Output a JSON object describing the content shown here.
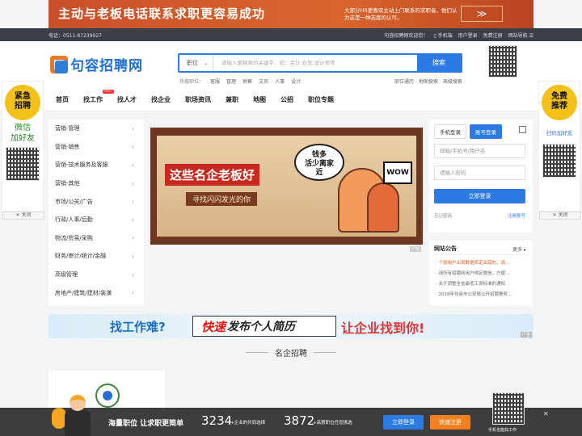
{
  "top_banner": {
    "headline": "主动与老板电话联系求职更容易成功",
    "subtext": "大部分HR更喜欢主动上门联系的求职者，他们认为这是一种态度的认可。",
    "arrow": "≫"
  },
  "topbar": {
    "phone": "电话：0511-87239927",
    "welcome": "句容招聘网欢迎您！",
    "links": [
      "手机端",
      "用户登录",
      "免费注册",
      "网站导航"
    ]
  },
  "logo": {
    "text": "句容招聘网"
  },
  "search": {
    "select_value": "职位",
    "placeholder": "请输入要搜索的关键字，如：会计,仓管,设计师等",
    "button": "搜索",
    "hot_label": "热搜职位：",
    "hot_terms": [
      "客服",
      "管理",
      "销售",
      "文员",
      "人事",
      "设计"
    ],
    "right_links": [
      "职位通历",
      "地图搜索",
      "高级搜索"
    ]
  },
  "nav": {
    "items": [
      "首页",
      "找工作",
      "找人才",
      "找企业",
      "职场资讯",
      "兼职",
      "地图",
      "公招",
      "职位专题"
    ],
    "hot_badge": "HOT"
  },
  "left_float": {
    "badge": "紧急\n招聘",
    "text": "微信\n加好友",
    "close": "关闭"
  },
  "right_float": {
    "badge": "免费\n推荐",
    "text": "扫码加好友",
    "close": "关闭"
  },
  "categories": [
    "营销-管理",
    "营销-销售",
    "营销-技术服务及客服",
    "营销-其他",
    "市场/公关/广告",
    "行政/人事/后勤",
    "物流/贸易/采购",
    "财务/审计/统计/金融",
    "高级管理",
    "房地产/建筑/建材/装潢"
  ],
  "main_banner": {
    "title": "这些名企老板好",
    "subtitle": "寻找闪闪发光的你",
    "bubble": "钱多\n活少离家\n近",
    "wow": "WOW",
    "ad_tag": "广告"
  },
  "login": {
    "tab_phone": "手机登录",
    "tab_account": "账号登录",
    "username_placeholder": "邮箱/手机号/用户名",
    "password_placeholder": "请输入密码",
    "submit": "立即登录",
    "forgot": "忘记密码",
    "register": "注册账号"
  },
  "notice": {
    "title": "网站公告",
    "more": "更多 ▸",
    "items": [
      "· 个别用户出现数据库定出错的，请...",
      "· 请所有招聘网用户绑定微信，方便...",
      "· 关于调整全省最低工资标准的通知",
      "· 2018年句容市公安局公开招聘警务..."
    ]
  },
  "mid_banner": {
    "left": "找工作难?",
    "highlight": "快速",
    "middle": "发布个人简历",
    "right": "让企业找到你!",
    "ad_tag": "广告"
  },
  "section": {
    "title": "名企招聘"
  },
  "bottom_bar": {
    "slogan": "海量职位 让求职更简单",
    "jobs_count": "3234",
    "jobs_label": "+企业的共同选择",
    "positions_count": "3872",
    "positions_label": "+高薪职位任您挑选",
    "login_button": "立即登录",
    "register_button": "快速注册",
    "qr_label": "手机也能找工作",
    "close": "✕"
  }
}
